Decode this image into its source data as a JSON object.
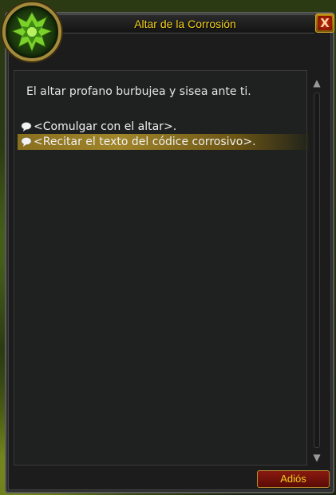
{
  "window": {
    "title": "Altar de la Corrosión",
    "close_label": "X"
  },
  "dialog": {
    "greeting": "El altar profano burbujea y sisea ante ti.",
    "options": [
      {
        "label": "<Comulgar con el altar>.",
        "icon": "speech-bubble-icon",
        "selected": false
      },
      {
        "label": "<Recitar el texto del códice corrosivo>.",
        "icon": "speech-bubble-icon",
        "selected": true
      }
    ]
  },
  "footer": {
    "goodbye_label": "Adiós"
  },
  "colors": {
    "title": "#f2cf1a",
    "highlight": "#a0852a",
    "button": "#8a1a10"
  }
}
